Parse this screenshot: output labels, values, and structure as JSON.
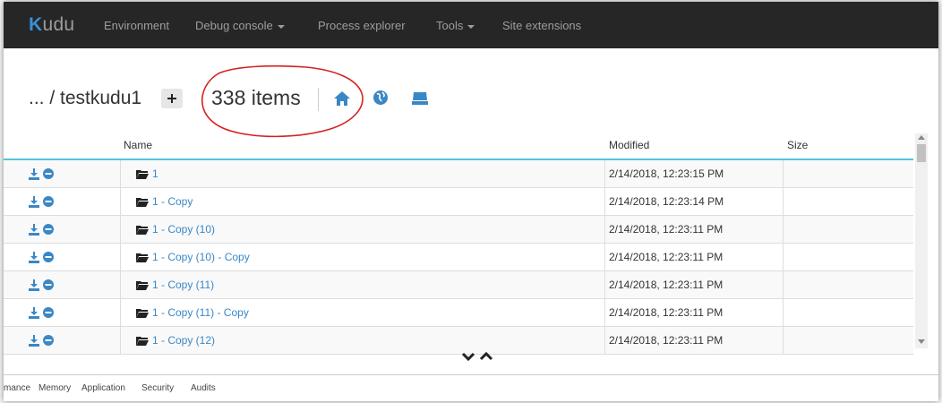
{
  "navbar": {
    "brand_initial": "K",
    "brand_rest": "udu",
    "items": [
      {
        "label": "Environment",
        "dropdown": false
      },
      {
        "label": "Debug console",
        "dropdown": true
      },
      {
        "label": "Process explorer",
        "dropdown": false
      },
      {
        "label": "Tools",
        "dropdown": true
      },
      {
        "label": "Site extensions",
        "dropdown": false
      }
    ]
  },
  "header": {
    "breadcrumb": "... / testkudu1",
    "item_count": "338 items",
    "icons": [
      "home-icon",
      "globe-icon",
      "drive-icon"
    ]
  },
  "table": {
    "columns": [
      "Name",
      "Modified",
      "Size"
    ],
    "rows": [
      {
        "name": "1",
        "modified": "2/14/2018, 12:23:15 PM",
        "size": ""
      },
      {
        "name": "1 - Copy",
        "modified": "2/14/2018, 12:23:14 PM",
        "size": ""
      },
      {
        "name": "1 - Copy (10)",
        "modified": "2/14/2018, 12:23:11 PM",
        "size": ""
      },
      {
        "name": "1 - Copy (10) - Copy",
        "modified": "2/14/2018, 12:23:11 PM",
        "size": ""
      },
      {
        "name": "1 - Copy (11)",
        "modified": "2/14/2018, 12:23:11 PM",
        "size": ""
      },
      {
        "name": "1 - Copy (11) - Copy",
        "modified": "2/14/2018, 12:23:11 PM",
        "size": ""
      },
      {
        "name": "1 - Copy (12)",
        "modified": "2/14/2018, 12:23:11 PM",
        "size": ""
      }
    ]
  },
  "bottom_tabs": [
    "mance",
    "Memory",
    "Application",
    "Security",
    "Audits"
  ],
  "colors": {
    "navbar_bg": "#262626",
    "link": "#3a87c5",
    "annotation": "#d62020",
    "header_border": "#5bc0de"
  }
}
